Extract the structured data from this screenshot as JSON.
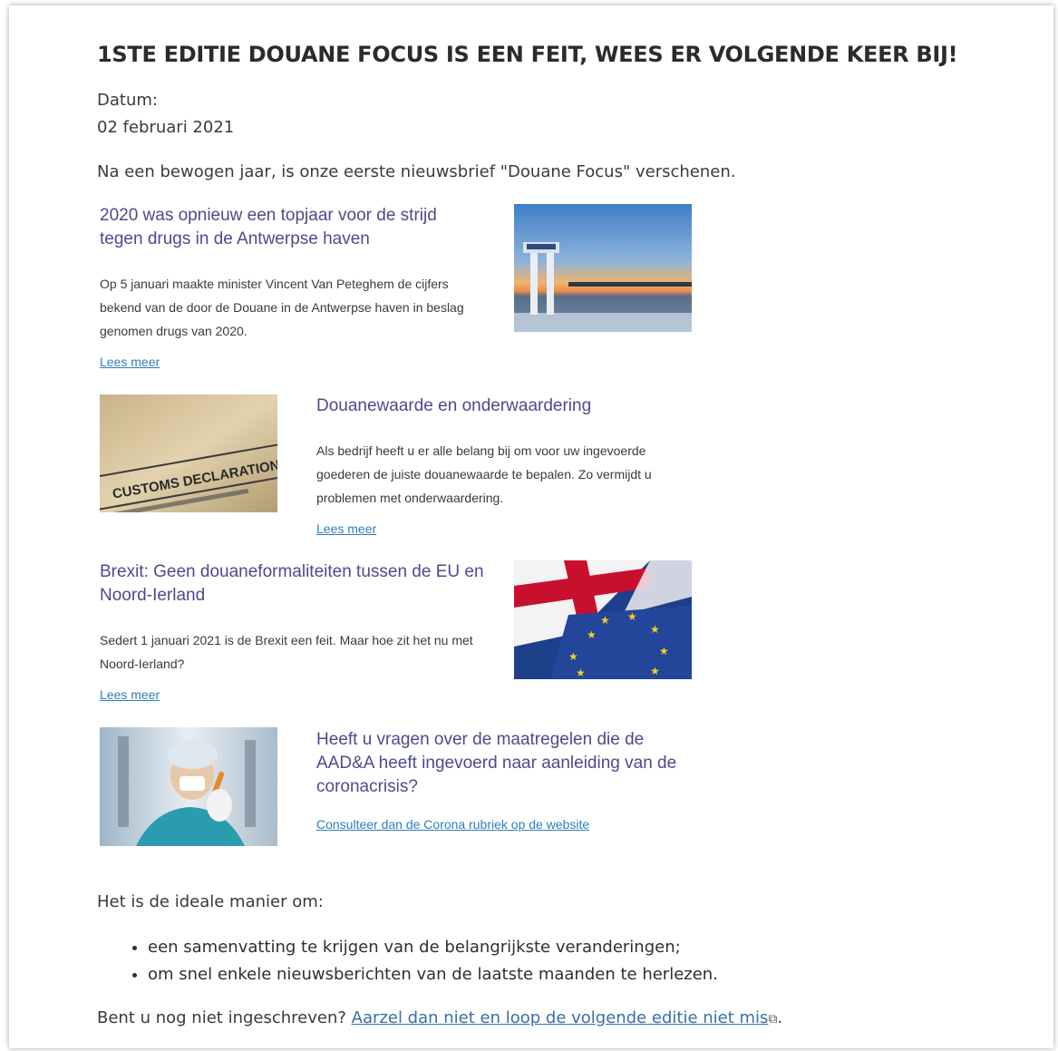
{
  "title": "1STE EDITIE DOUANE FOCUS IS EEN FEIT, WEES ER VOLGENDE KEER BIJ!",
  "date_label": "Datum:",
  "date_value": "02 februari 2021",
  "intro": "Na een bewogen jaar, is onze eerste nieuwsbrief  \"Douane Focus\"  verschenen.",
  "articles": [
    {
      "title": "2020 was opnieuw een topjaar voor de strijd tegen drugs in de Antwerpse haven",
      "text": "Op 5 januari maakte minister Vincent Van Peteghem de cijfers bekend van de door de Douane in de Antwerpse haven in beslag genomen drugs van 2020.",
      "link": "Lees meer"
    },
    {
      "title": "Douanewaarde en onderwaardering",
      "text": "Als bedrijf heeft u er alle belang bij om voor uw ingevoerde goederen de juiste douanewaarde te bepalen. Zo vermijdt u problemen met onderwaardering.",
      "link": "Lees meer",
      "image_text": "CUSTOMS DECLARATION"
    },
    {
      "title": "Brexit: Geen douaneformaliteiten tussen de EU en Noord-Ierland",
      "text": "Sedert 1 januari 2021 is de Brexit een feit. Maar hoe zit het nu met Noord-Ierland?",
      "link": "Lees meer"
    },
    {
      "title": "Heeft u vragen over de maatregelen die de AAD&A heeft ingevoerd naar aanleiding van de coronacrisis?",
      "link": "Consulteer dan de Corona rubriek op de website"
    }
  ],
  "ideal_intro": "Het is de ideale manier om:",
  "bullets": [
    "een samenvatting te krijgen van de belangrijkste veranderingen;",
    "om snel enkele nieuwsberichten van de laatste maanden te herlezen."
  ],
  "signup_question": "Bent u nog niet ingeschreven?",
  "signup_link": "Aarzel dan niet en loop de volgende editie niet mis",
  "signup_end": ".",
  "colors": {
    "article_title": "#4c4a8f",
    "link": "#2f7fb8",
    "body_link": "#3b6ea5"
  }
}
